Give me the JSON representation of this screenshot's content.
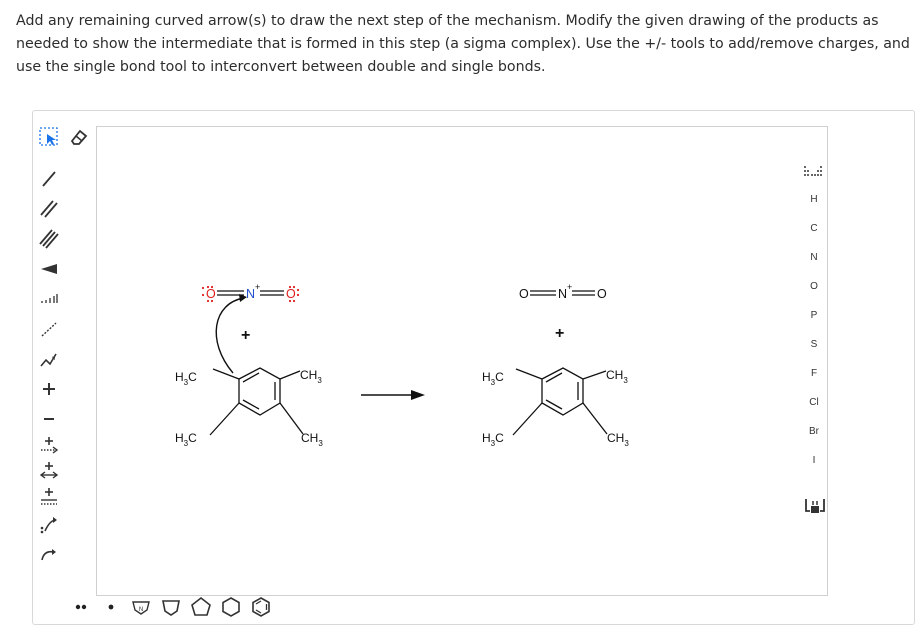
{
  "instructions": "Add any remaining curved arrow(s) to draw the next step of the mechanism. Modify the given drawing of the products as needed to show the intermediate that is formed in this step (a sigma complex). Use the +/- tools to add/remove charges, and use the single bond tool to interconvert between double and single bonds.",
  "colors": {
    "accent_blue": "#1a73e8",
    "oxygen_red": "#e02020",
    "nitrogen_blue": "#2050d0",
    "tool_gray": "#333333"
  },
  "top_toolbar": [
    "select-icon",
    "eraser-icon",
    "undo-icon",
    "redo-icon",
    "cut-icon",
    "copy-icon",
    "paste-icon",
    "clear-icon",
    "zoom-in-icon",
    "zoom-out-icon",
    "zoom-fit-icon",
    "help-icon"
  ],
  "left_toolbar": [
    "single-bond-icon",
    "double-bond-icon",
    "triple-bond-icon",
    "wedge-bond-icon",
    "hash-bond-icon",
    "wavy-bond-icon",
    "chain-icon",
    "plus-charge-icon",
    "minus-charge-icon",
    "radical-plus-icon",
    "radical-minus-icon",
    "lone-pair-plus-icon",
    "curved-arrow-pair-icon",
    "curved-arrow-single-icon",
    "curved-arrow-fishhook-icon"
  ],
  "bottom_toolbar": [
    "lone-pair-icon",
    "radical-dot-icon",
    "cyclopropane-icon",
    "cyclobutane-icon",
    "cyclopentane-icon",
    "cyclohexane-icon",
    "benzene-icon"
  ],
  "element_panel": {
    "elements": [
      "H",
      "C",
      "N",
      "O",
      "P",
      "S",
      "F",
      "Cl",
      "Br",
      "I"
    ]
  },
  "reactant": {
    "nitronium": {
      "o_left": "O",
      "n": "N",
      "charge": "+",
      "o_right": "O"
    },
    "plus_sign": "+",
    "substituents": {
      "top_left": "H",
      "top_left_c": "C",
      "top_left_sub": "3",
      "top_right": "CH",
      "top_right_sub": "3",
      "bottom_left": "H",
      "bottom_left_c": "C",
      "bottom_left_sub": "3",
      "bottom_right": "CH",
      "bottom_right_sub": "3"
    }
  },
  "product": {
    "nitronium": {
      "o_left": "O",
      "n": "N",
      "charge": "+",
      "o_right": "O"
    },
    "plus_sign": "+",
    "substituents": {
      "top_left": "H",
      "top_left_c": "C",
      "top_left_sub": "3",
      "top_right": "CH",
      "top_right_sub": "3",
      "bottom_left": "H",
      "bottom_left_c": "C",
      "bottom_left_sub": "3",
      "bottom_right": "CH",
      "bottom_right_sub": "3"
    }
  }
}
